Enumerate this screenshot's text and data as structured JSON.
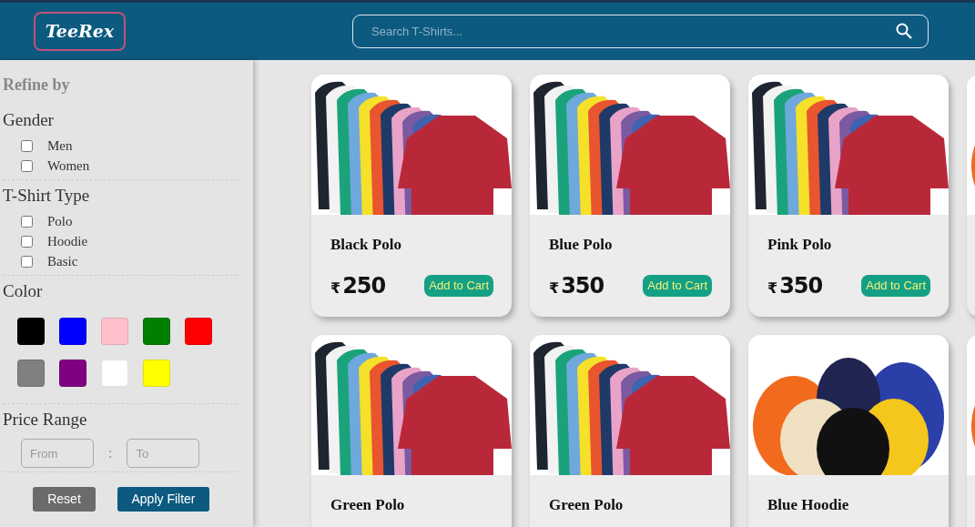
{
  "header": {
    "logo": "TeeRex",
    "search": {
      "placeholder": "Search T-Shirts..."
    }
  },
  "sidebar": {
    "title": "Refine by",
    "groups": [
      {
        "kind": "checks",
        "title": "Gender",
        "options": [
          {
            "label": "Men",
            "checked": false
          },
          {
            "label": "Women",
            "checked": false
          }
        ]
      },
      {
        "kind": "checks",
        "title": "T-Shirt Type",
        "options": [
          {
            "label": "Polo",
            "checked": false
          },
          {
            "label": "Hoodie",
            "checked": false
          },
          {
            "label": "Basic",
            "checked": false
          }
        ]
      },
      {
        "kind": "colors",
        "title": "Color",
        "swatches": [
          {
            "color": "#000000"
          },
          {
            "color": "#0000ff"
          },
          {
            "color": "#ffc0cb"
          },
          {
            "color": "#008000"
          },
          {
            "color": "#ff0000"
          },
          {
            "color": "#808080"
          },
          {
            "color": "#800080"
          },
          {
            "color": "#ffffff"
          },
          {
            "color": "#ffff00"
          }
        ]
      },
      {
        "kind": "range",
        "title": "Price Range",
        "from_placeholder": "From",
        "separator": ":",
        "to_placeholder": "To"
      }
    ],
    "buttons": [
      {
        "label": "Reset",
        "kind": "secondary"
      },
      {
        "label": "Apply Filter",
        "kind": "primary"
      }
    ]
  },
  "products": [
    {
      "kind": "polo",
      "name": "Black Polo",
      "currency": "₹",
      "price": "250",
      "button": "Add to Cart"
    },
    {
      "kind": "polo",
      "name": "Blue Polo",
      "currency": "₹",
      "price": "350",
      "button": "Add to Cart"
    },
    {
      "kind": "polo",
      "name": "Pink Polo",
      "currency": "₹",
      "price": "350",
      "button": "Add to Cart"
    },
    {
      "kind": "hoodie"
    },
    {
      "kind": "polo",
      "name": "Green Polo"
    },
    {
      "kind": "polo",
      "name": "Green Polo"
    },
    {
      "kind": "hoodie",
      "name": "Blue Hoodie"
    },
    {
      "kind": "hoodie"
    }
  ]
}
